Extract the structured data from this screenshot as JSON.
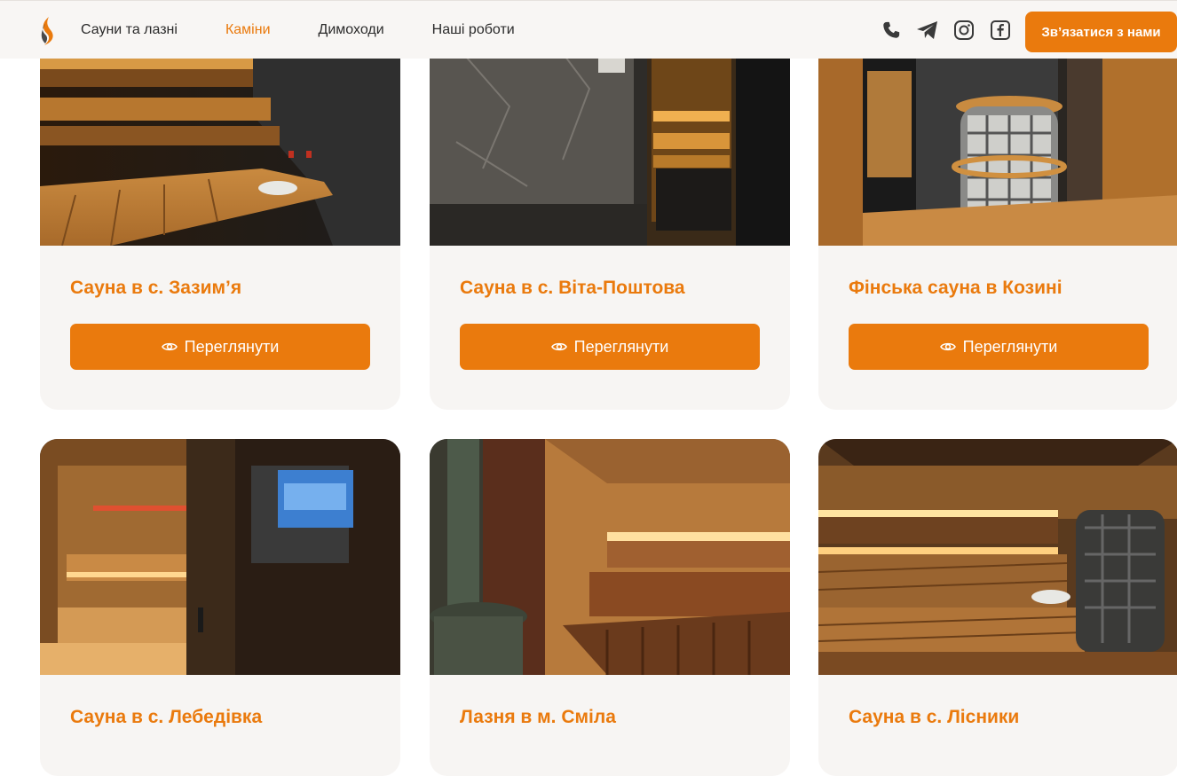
{
  "header": {
    "nav": [
      {
        "label": "Сауни та лазні",
        "active": false
      },
      {
        "label": "Каміни",
        "active": true
      },
      {
        "label": "Димоходи",
        "active": false
      },
      {
        "label": "Наші роботи",
        "active": false
      }
    ],
    "icons": [
      "phone-icon",
      "telegram-icon",
      "instagram-icon",
      "facebook-icon"
    ],
    "contact_label": "Зв’язатися з нами"
  },
  "colors": {
    "accent": "#ea7a0d",
    "card_bg": "#f7f5f3",
    "header_bg": "#f8f6f4"
  },
  "cards": [
    {
      "title": "Сауна в с. Зазим’я",
      "button": "Переглянути"
    },
    {
      "title": "Сауна в с. Віта-Поштова",
      "button": "Переглянути"
    },
    {
      "title": "Фінська сауна в Козині",
      "button": "Переглянути"
    },
    {
      "title": "Сауна в с. Лебедівка"
    },
    {
      "title": "Лазня в м. Сміла"
    },
    {
      "title": "Сауна в с. Лісники"
    }
  ]
}
